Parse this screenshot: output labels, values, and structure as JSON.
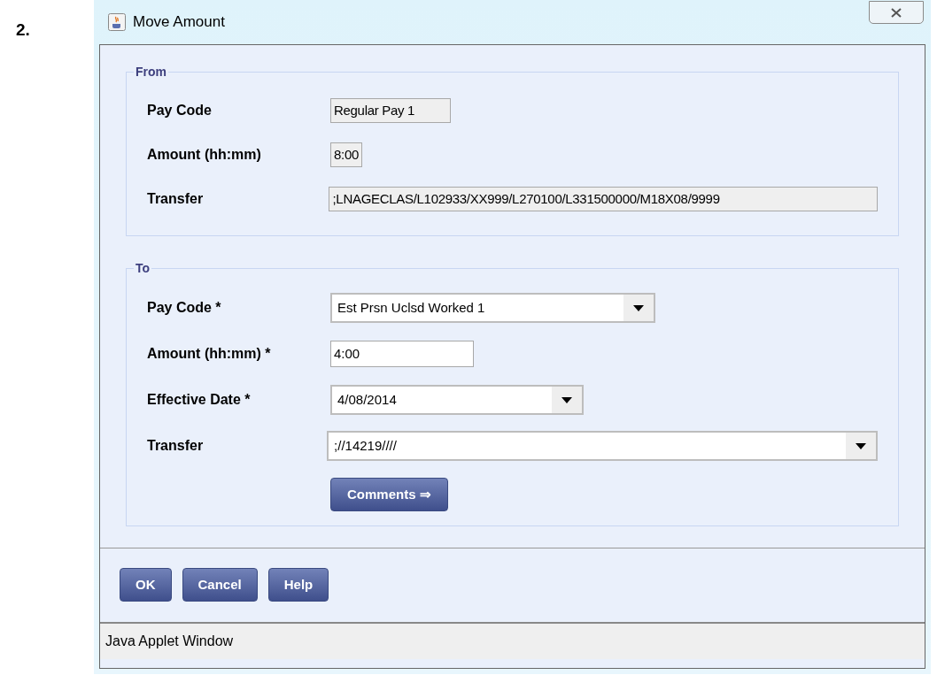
{
  "step_number": "2.",
  "window": {
    "title": "Move Amount"
  },
  "from": {
    "legend": "From",
    "fields": [
      {
        "label": "Pay Code",
        "value": "Regular Pay 1",
        "kind": "readonly"
      },
      {
        "label": "Amount (hh:mm)",
        "value": "8:00",
        "kind": "readonly"
      },
      {
        "label": "Transfer",
        "value": ";LNAGECLAS/L102933/XX999/L270100/L331500000/M18X08/9999",
        "kind": "readonly"
      }
    ]
  },
  "to": {
    "legend": "To",
    "fields": [
      {
        "label": "Pay Code *",
        "value": "Est Prsn Uclsd Worked 1",
        "kind": "dropdown"
      },
      {
        "label": "Amount (hh:mm) *",
        "value": "4:00",
        "kind": "text"
      },
      {
        "label": "Effective Date *",
        "value": "4/08/2014",
        "kind": "dropdown"
      },
      {
        "label": "Transfer",
        "value": ";//14219////",
        "kind": "dropdown"
      }
    ],
    "comments_button": "Comments ⇒"
  },
  "buttons": [
    "OK",
    "Cancel",
    "Help"
  ],
  "status_bar": "Java Applet Window"
}
